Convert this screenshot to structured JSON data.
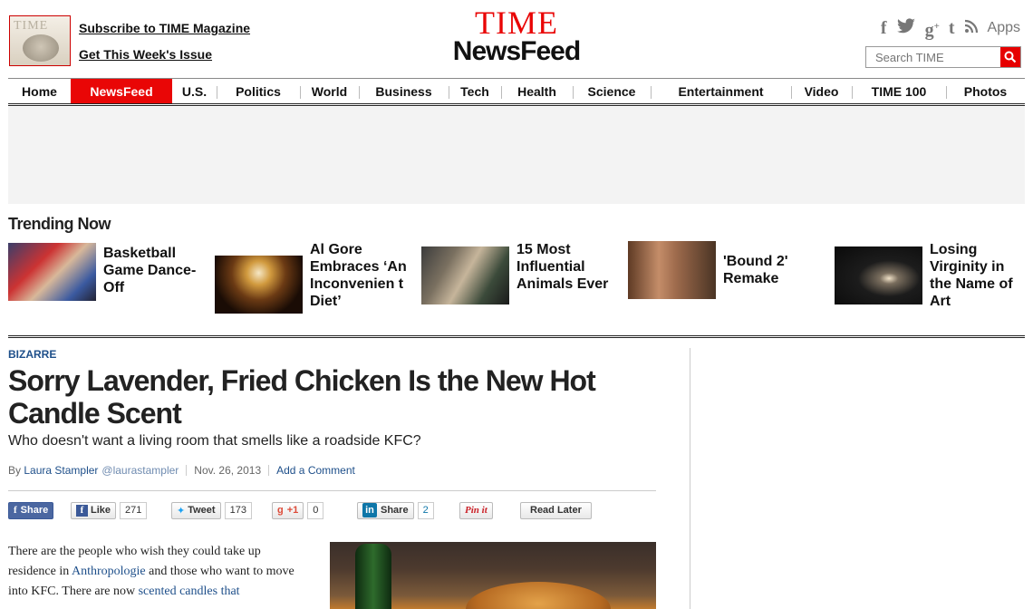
{
  "header": {
    "cover_title": "TIME",
    "subscribe_link": "Subscribe to TIME Magazine",
    "issue_link": "Get This Week's Issue",
    "logo_top": "TIME",
    "logo_bottom": "NewsFeed",
    "social_icons": [
      "facebook-icon",
      "twitter-icon",
      "google-plus-icon",
      "tumblr-icon",
      "rss-icon"
    ],
    "apps_label": "Apps",
    "search_placeholder": "Search TIME",
    "accent_color": "#e90606"
  },
  "nav": {
    "items": [
      "Home",
      "NewsFeed",
      "U.S.",
      "Politics",
      "World",
      "Business",
      "Tech",
      "Health",
      "Science",
      "Entertainment",
      "Video",
      "TIME 100",
      "Photos"
    ],
    "active": "NewsFeed"
  },
  "trending": {
    "title": "Trending Now",
    "items": [
      {
        "title": "Basketball Game Dance-Off"
      },
      {
        "title": "Al Gore Embraces ‘An Inconvenien t Diet’"
      },
      {
        "title": "15 Most Influential Animals Ever"
      },
      {
        "title": "'Bound 2' Remake"
      },
      {
        "title": "Losing Virginity in the Name of Art"
      }
    ]
  },
  "article": {
    "kicker": "BIZARRE",
    "headline": "Sorry Lavender, Fried Chicken Is the New Hot Candle Scent",
    "dek": "Who doesn't want a living room that smells like a roadside KFC?",
    "byline_prefix": "By",
    "author": "Laura Stampler",
    "handle": "@laurastampler",
    "date": "Nov. 26, 2013",
    "comment_link": "Add a Comment",
    "body_lines": {
      "p1": "There are the people who wish they could take up residence in ",
      "link1": "Anthropologie",
      "p2": " and those who want to move into KFC. There are now ",
      "link2": "scented candles that",
      "p3": ""
    }
  },
  "share": {
    "fb_share": "Share",
    "fb_like": "Like",
    "fb_like_count": "271",
    "tweet": "Tweet",
    "tweet_count": "173",
    "gplus": "+1",
    "gplus_count": "0",
    "linkedin": "Share",
    "linkedin_count": "2",
    "pinit": "Pin it",
    "read_later": "Read Later"
  }
}
